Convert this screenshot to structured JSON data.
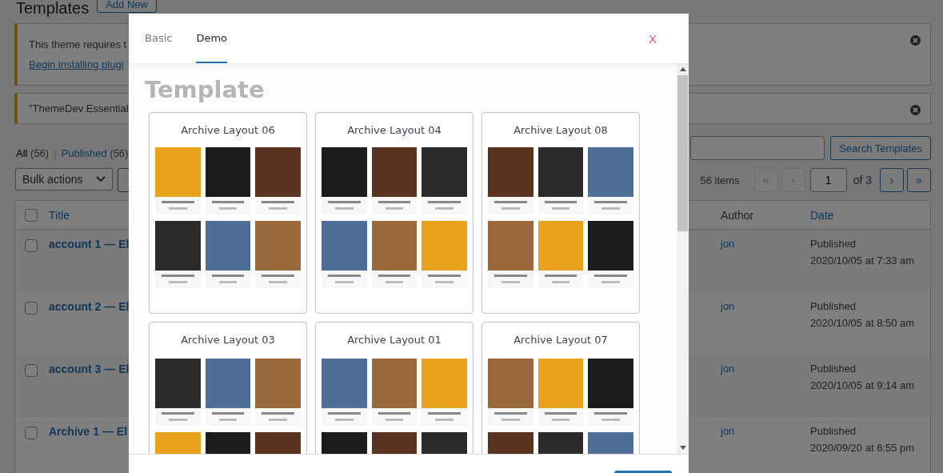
{
  "page": {
    "title": "Templates",
    "add_new": "Add New"
  },
  "notices": [
    {
      "text": "This theme requires t",
      "link": "Begin installing plugi"
    },
    {
      "text": "\"ThemeDev Essential"
    }
  ],
  "views": [
    {
      "label": "All",
      "count": "(56)",
      "selected": true
    },
    {
      "label": "Published",
      "count": "(56)",
      "selected": false
    }
  ],
  "views_separator": "|",
  "search": {
    "button": "Search Templates"
  },
  "bulk_actions": "Bulk actions",
  "pagination": {
    "items": "56 items",
    "page": "1",
    "of": "of 3",
    "buttons": [
      {
        "label": "«",
        "disabled": true
      },
      {
        "label": "‹",
        "disabled": true
      },
      {
        "label": "›",
        "disabled": false
      },
      {
        "label": "»",
        "disabled": false
      }
    ]
  },
  "table": {
    "select_all_checked": false,
    "columns": [
      "Title",
      "Author",
      "Date"
    ],
    "rows": [
      {
        "title": "account 1 — El",
        "checked": false,
        "author": "jon",
        "status": "Published",
        "date": "2020/10/05 at 7:33 am"
      },
      {
        "title": "account 2 — El",
        "checked": false,
        "author": "jon",
        "status": "Published",
        "date": "2020/10/05 at 8:50 am"
      },
      {
        "title": "account 3 — El",
        "checked": false,
        "author": "jon",
        "status": "Published",
        "date": "2020/10/05 at 9:14 am"
      },
      {
        "title": "Archive 1 — El",
        "checked": false,
        "author": "jon",
        "status": "Published",
        "date": "2020/09/20 at 6:55 pm"
      }
    ]
  },
  "modal": {
    "tabs": [
      {
        "label": "Basic",
        "selected": false
      },
      {
        "label": "Demo",
        "selected": true
      }
    ],
    "close": "X",
    "heading": "Template",
    "templates": [
      {
        "name": "Archive Layout 06"
      },
      {
        "name": "Archive Layout 04"
      },
      {
        "name": "Archive Layout 08"
      },
      {
        "name": "Archive Layout 03"
      },
      {
        "name": "Archive Layout 01"
      },
      {
        "name": "Archive Layout 07"
      }
    ]
  }
}
